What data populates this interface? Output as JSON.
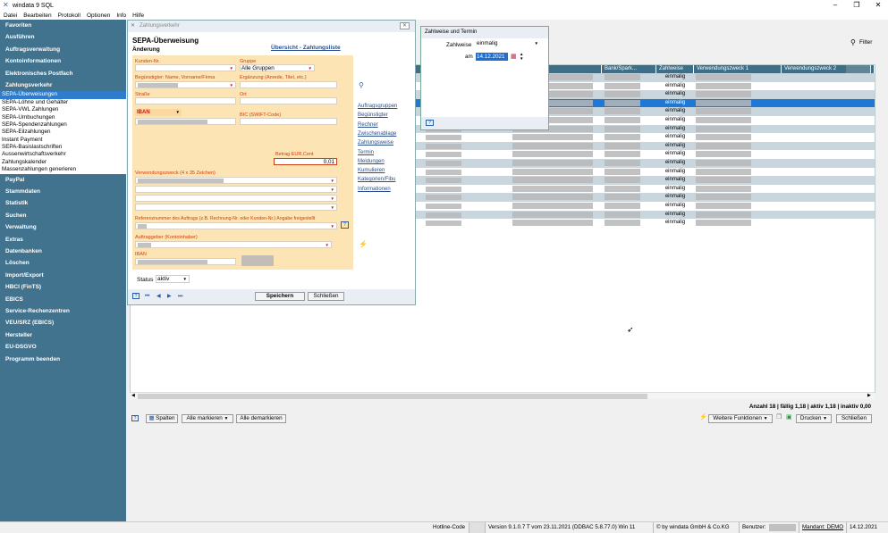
{
  "window": {
    "title": "windata 9 SQL"
  },
  "menu": [
    "Datei",
    "Bearbeiten",
    "Protokoll",
    "Optionen",
    "Info",
    "Hilfe"
  ],
  "sidebar": {
    "top_sections": [
      "Favoriten",
      "Ausführen",
      "Auftragsverwaltung",
      "Kontoinformationen",
      "Elektronisches Postfach",
      "Zahlungsverkehr"
    ],
    "sub_items": [
      "SEPA-Überweisungen",
      "SEPA-Löhne und Gehälter",
      "SEPA-VWL Zahlungen",
      "SEPA-Umbuchungen",
      "SEPA-Spendenzahlungen",
      "SEPA-Eilzahlungen",
      "Instant Payment",
      "SEPA-Basislastschriften",
      "Aussenwirtschaftsverkehr",
      "Zahlungskalender",
      "Massenzahlungen generieren"
    ],
    "selected_sub": "SEPA-Überweisungen",
    "bottom_sections": [
      "PayPal",
      "Stammdaten",
      "Statistik",
      "Suchen",
      "Verwaltung",
      "Extras",
      "Datenbanken",
      "Löschen",
      "Import/Export",
      "HBCI (FinTS)",
      "EBICS",
      "Service-Rechenzentren",
      "VEU/SRZ (EBICS)",
      "Hersteller",
      "EU-DSGVO",
      "Programm beenden"
    ]
  },
  "grid": {
    "filter_label": "Filter",
    "columns": [
      "Bank/Spark...",
      "Zahlweise",
      "Verwendungszweck 1",
      "Verwendungszweck 2"
    ],
    "row_value": "einmalig",
    "summary": "Anzahl 18 | fällig 1,18 | aktiv 1,18 | inaktiv 0,00"
  },
  "dialog": {
    "window_title": "Zahlungsverkehr",
    "heading": "SEPA-Überweisung",
    "subheading": "Änderung",
    "overview_link": "Übersicht - Zahlungsliste",
    "labels": {
      "kunden_nr": "Kunden-Nr.",
      "gruppe": "Gruppe",
      "beguenstigter": "Begünstigter: Name, Vorname/Firma",
      "ergaenzung": "Ergänzung (Anrede, Titel, etc.)",
      "strasse": "Straße",
      "ort": "Ort",
      "iban": "IBAN",
      "bic": "BIC (SWIFT-Code)",
      "betrag": "Betrag EUR,Cent",
      "verwendungszweck": "Verwendungszweck (4 x 35 Zeichen)",
      "referenz": "Referenznummer des Auftrags (z.B. Rechnung-Nr. oder Kunden-Nr.) Angabe freigestellt",
      "auftraggeber": "Auftraggeber (Kontoinhaber)",
      "iban2": "IBAN",
      "status": "Status"
    },
    "values": {
      "gruppe": "Alle Gruppen",
      "betrag": "0,01",
      "status": "aktiv"
    },
    "side_links": [
      "Auftragsgruppen",
      "Begünstigter",
      "Rechner",
      "Zwischenablage",
      "Zahlungsweise",
      "Termin",
      "Meldungen",
      "Kumulieren",
      "Kategorien/Fibu",
      "Informationen"
    ],
    "buttons": {
      "save": "Speichern",
      "close": "Schließen"
    }
  },
  "popup": {
    "title": "Zahlweise und Termin",
    "zahlweise_label": "Zahlweise",
    "zahlweise_value": "einmalig",
    "am_label": "am",
    "date_value": "14.12.2021"
  },
  "toolbar": {
    "spalten": "Spalten",
    "alle_markieren": "Alle markieren",
    "alle_demarkieren": "Alle demarkieren",
    "weitere_funktionen": "Weitere Funktionen",
    "drucken": "Drucken",
    "schliessen": "Schließen"
  },
  "status": {
    "hotline": "Hotline-Code",
    "version": "Version 9.1.0.7 T vom 23.11.2021 (DDBAC 5.8.77.0) Win 11",
    "copyright": "© by windata GmbH & Co.KG",
    "benutzer": "Benutzer:",
    "mandant": "Mandant: DEMO",
    "date": "14.12.2021"
  }
}
